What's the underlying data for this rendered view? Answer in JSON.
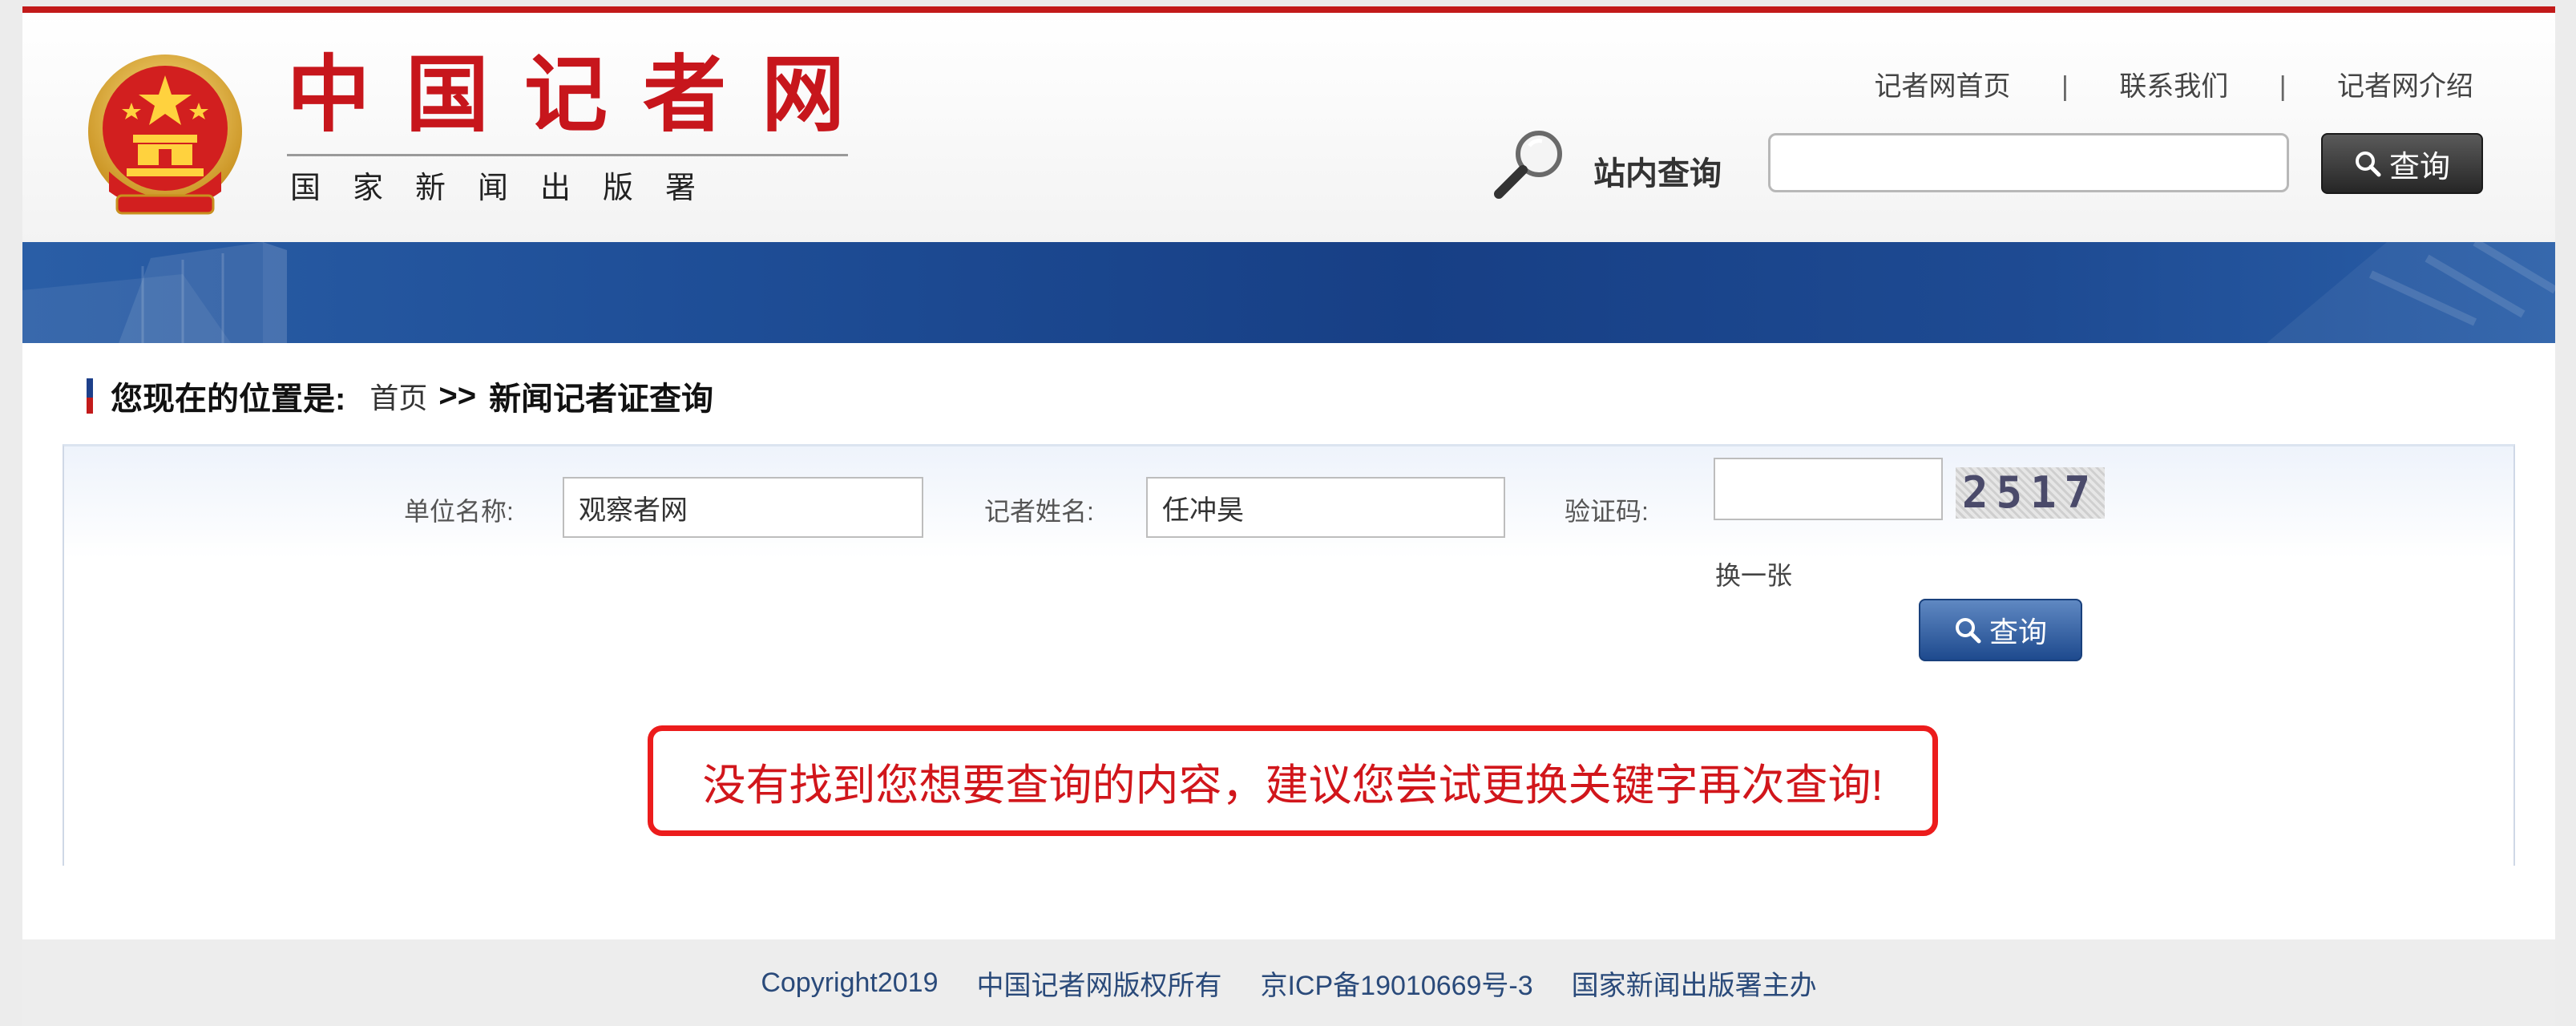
{
  "site": {
    "title": "中国记者网",
    "subtitle": "国家新闻出版署"
  },
  "top_links": [
    {
      "label": "记者网首页"
    },
    {
      "label": "联系我们"
    },
    {
      "label": "记者网介绍"
    }
  ],
  "top_link_separator": "|",
  "site_search": {
    "label": "站内查询",
    "value": "",
    "button_label": "查询"
  },
  "breadcrumb": {
    "label": "您现在的位置是:",
    "home": "首页",
    "separator": ">>",
    "current": "新闻记者证查询"
  },
  "query_form": {
    "unit_label": "单位名称:",
    "unit_value": "观察者网",
    "name_label": "记者姓名:",
    "name_value": "任冲昊",
    "captcha_label": "验证码:",
    "captcha_value": "",
    "captcha_code": "2517",
    "refresh_label": "换一张",
    "submit_label": "查询"
  },
  "notice": "没有找到您想要查询的内容，建议您尝试更换关键字再次查询!",
  "footer": {
    "copyright": "Copyright2019",
    "rights": "中国记者网版权所有",
    "icp": "京ICP备19010669号-3",
    "sponsor": "国家新闻出版署主办"
  },
  "colors": {
    "brand_red": "#c7161c",
    "banner_blue": "#1f4f98",
    "notice_red": "#ec1c1c",
    "footer_text": "#2a4a7a"
  },
  "icons": [
    "national-emblem-icon",
    "magnifier-icon",
    "search-icon"
  ]
}
